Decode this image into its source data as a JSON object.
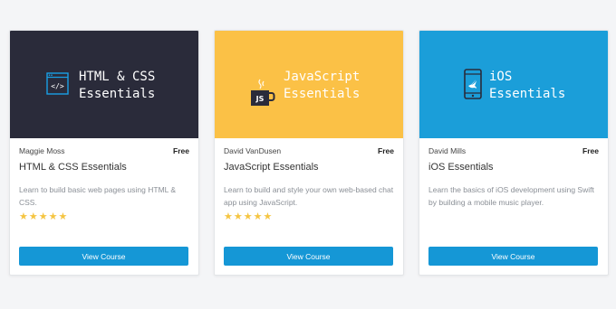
{
  "colors": {
    "page_background": "#f4f5f7",
    "html_banner": "#2a2b3a",
    "js_banner": "#fbc146",
    "ios_banner": "#1b9ed9",
    "button": "#1597d6",
    "star": "#f5c542"
  },
  "cards": [
    {
      "banner_icon": "html-code-window-icon",
      "banner_title": "HTML & CSS\nEssentials",
      "author": "Maggie Moss",
      "price": "Free",
      "title": "HTML & CSS Essentials",
      "description": "Learn to build basic web pages using HTML & CSS.",
      "rating": 5,
      "rating_max": 5,
      "button_label": "View Course"
    },
    {
      "banner_icon": "javascript-coffee-cup-icon",
      "banner_title": "JavaScript\nEssentials",
      "author": "David VanDusen",
      "price": "Free",
      "title": "JavaScript Essentials",
      "description": "Learn to build and style your own web-based chat app using JavaScript.",
      "rating": 5,
      "rating_max": 5,
      "button_label": "View Course"
    },
    {
      "banner_icon": "ios-swift-phone-icon",
      "banner_title": "iOS\nEssentials",
      "author": "David Mills",
      "price": "Free",
      "title": "iOS Essentials",
      "description": "Learn the basics of iOS development using Swift by building a mobile music player.",
      "rating": null,
      "rating_max": 5,
      "button_label": "View Course"
    }
  ]
}
